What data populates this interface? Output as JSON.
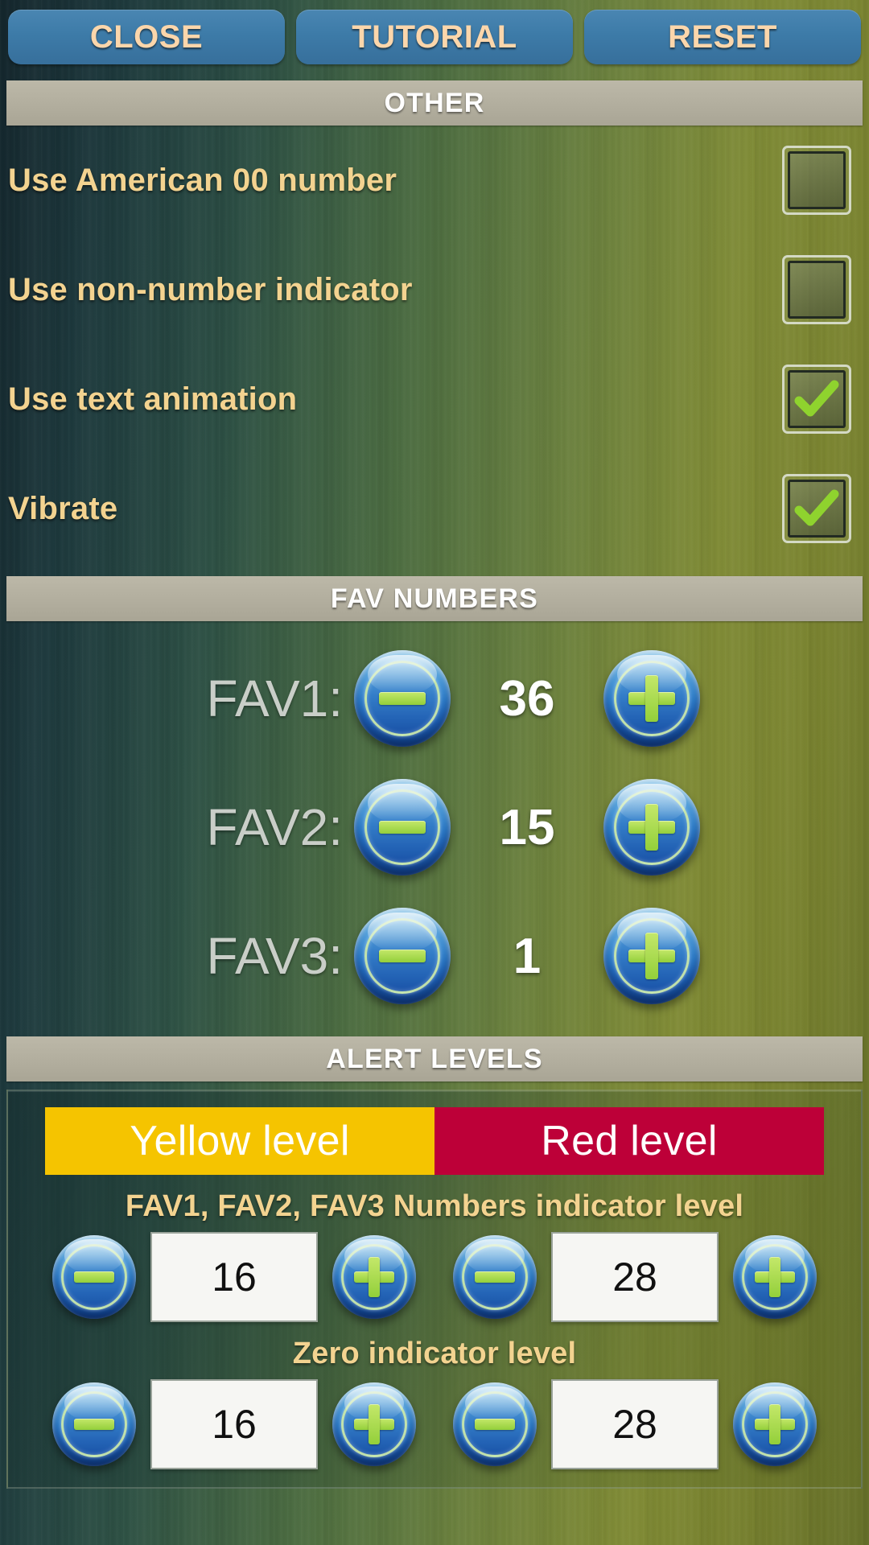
{
  "topbar": {
    "buttons": [
      {
        "label": "CLOSE",
        "name": "close-button"
      },
      {
        "label": "TUTORIAL",
        "name": "tutorial-button"
      },
      {
        "label": "RESET",
        "name": "reset-button"
      }
    ]
  },
  "sections": {
    "other_header": "OTHER",
    "fav_header": "FAV NUMBERS",
    "alert_header": "ALERT LEVELS"
  },
  "other": {
    "options": [
      {
        "label": "Use American 00 number",
        "checked": false
      },
      {
        "label": "Use non-number indicator",
        "checked": false
      },
      {
        "label": "Use text animation",
        "checked": true
      },
      {
        "label": "Vibrate",
        "checked": true
      }
    ]
  },
  "fav_numbers": {
    "rows": [
      {
        "label": "FAV1:",
        "value": "36"
      },
      {
        "label": "FAV2:",
        "value": "15"
      },
      {
        "label": "FAV3:",
        "value": "1"
      }
    ],
    "decrement_label": "-",
    "increment_label": "+"
  },
  "alert_levels": {
    "tabs": [
      {
        "label": "Yellow level",
        "color": "#f5c400"
      },
      {
        "label": "Red level",
        "color": "#bd0038"
      }
    ],
    "groups": [
      {
        "caption": "FAV1, FAV2, FAV3 Numbers indicator level",
        "yellow_value": "16",
        "red_value": "28"
      },
      {
        "caption": "Zero indicator level",
        "yellow_value": "16",
        "red_value": "28"
      }
    ]
  },
  "colors": {
    "button_blue": "#3d7ba8",
    "button_text": "#fbd6ab",
    "section_bar": "#b2ae9e",
    "label_sand": "#f3d390",
    "fav_label_grey": "#c9cec8",
    "value_white": "#ffffff",
    "check_green": "#8fd32e",
    "yellow_level": "#f5c400",
    "red_level": "#bd0038"
  }
}
